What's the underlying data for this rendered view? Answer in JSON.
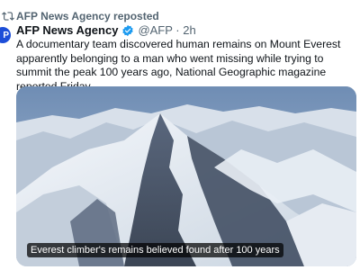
{
  "repost": {
    "text": "AFP News Agency reposted",
    "icon": "repost-icon"
  },
  "author": {
    "avatar_letter": "P",
    "avatar_color": "#1d4ed8",
    "name": "AFP News Agency",
    "verified_icon": "verified-badge-icon",
    "verified_color": "#1d9bf0",
    "handle_time": "@AFP · 2h"
  },
  "tweet": {
    "text": "A documentary team discovered human remains on Mount Everest apparently belonging to a man who went missing while trying to summit the peak 100 years ago, National Geographic magazine reported Friday."
  },
  "media": {
    "caption": "Everest climber's remains believed found after 100 years"
  },
  "colors": {
    "secondary_text": "#536471",
    "primary_text": "#0f1419"
  }
}
